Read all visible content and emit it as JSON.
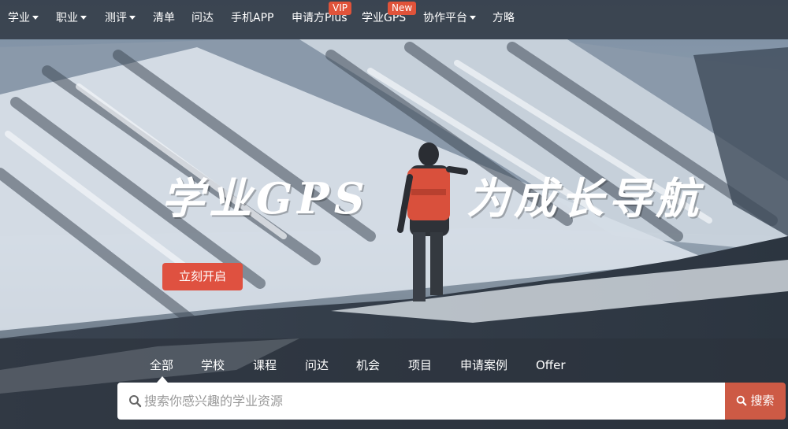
{
  "nav": {
    "items": [
      {
        "label": "学业",
        "dropdown": true
      },
      {
        "label": "职业",
        "dropdown": true
      },
      {
        "label": "测评",
        "dropdown": true
      },
      {
        "label": "清单",
        "dropdown": false
      },
      {
        "label": "问达",
        "dropdown": false
      },
      {
        "label": "手机APP",
        "dropdown": false
      },
      {
        "label": "申请方Plus",
        "dropdown": false,
        "badge": "VIP"
      },
      {
        "label": "学业GPS",
        "dropdown": false,
        "badge": "New"
      },
      {
        "label": "协作平台",
        "dropdown": true
      },
      {
        "label": "方略",
        "dropdown": false
      }
    ],
    "dropdown_icon": "caret-down-icon"
  },
  "hero": {
    "title_left": "学业GPS",
    "title_right": "为成长导航",
    "cta_label": "立刻开启"
  },
  "search": {
    "tabs": [
      "全部",
      "学校",
      "课程",
      "问达",
      "机会",
      "项目",
      "申请案例",
      "Offer"
    ],
    "active_tab": "全部",
    "placeholder": "搜索你感兴趣的学业资源",
    "value": "",
    "button_label": "搜索",
    "icon": "search-icon"
  },
  "colors": {
    "accent": "#df5140",
    "search_button": "#cd5a45",
    "badge": "#e0533a"
  }
}
